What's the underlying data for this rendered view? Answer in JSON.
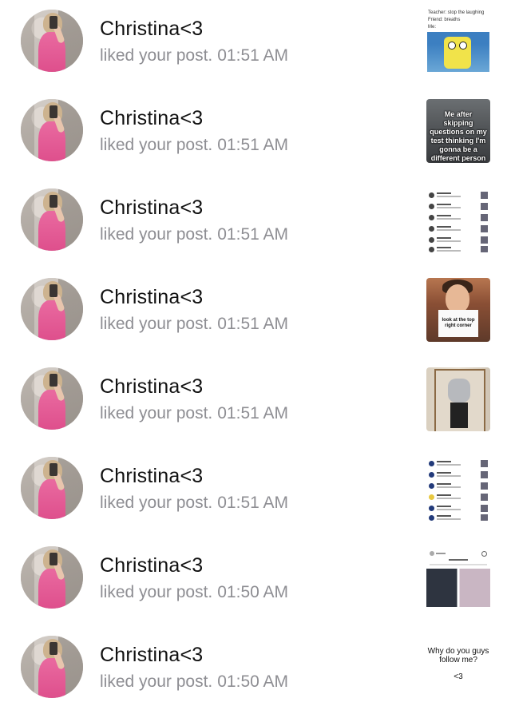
{
  "notifications": [
    {
      "user": "Christina<3",
      "action": "liked your post.",
      "time": "01:51 AM",
      "thumb_icon": "meme-thumbnail",
      "thumb_text": [
        "Teacher: stop the laughing",
        "Friend: breaths",
        "Me:"
      ]
    },
    {
      "user": "Christina<3",
      "action": "liked your post.",
      "time": "01:51 AM",
      "thumb_icon": "meme-thumbnail",
      "thumb_text": [
        "Me after skipping questions on my test thinking I'm gonna be a different person when I go back to them"
      ]
    },
    {
      "user": "Christina<3",
      "action": "liked your post.",
      "time": "01:51 AM",
      "thumb_icon": "screenshot-thumbnail"
    },
    {
      "user": "Christina<3",
      "action": "liked your post.",
      "time": "01:51 AM",
      "thumb_icon": "photo-thumbnail",
      "thumb_text": [
        "look at the top right corner"
      ]
    },
    {
      "user": "Christina<3",
      "action": "liked your post.",
      "time": "01:51 AM",
      "thumb_icon": "photo-thumbnail"
    },
    {
      "user": "Christina<3",
      "action": "liked your post.",
      "time": "01:51 AM",
      "thumb_icon": "screenshot-thumbnail"
    },
    {
      "user": "Christina<3",
      "action": "liked your post.",
      "time": "01:50 AM",
      "thumb_icon": "screenshot-thumbnail"
    },
    {
      "user": "Christina<3",
      "action": "liked your post.",
      "time": "01:50 AM",
      "thumb_icon": "text-post-thumbnail",
      "thumb_text": [
        "Why do you guys follow me?",
        "<3"
      ]
    }
  ]
}
